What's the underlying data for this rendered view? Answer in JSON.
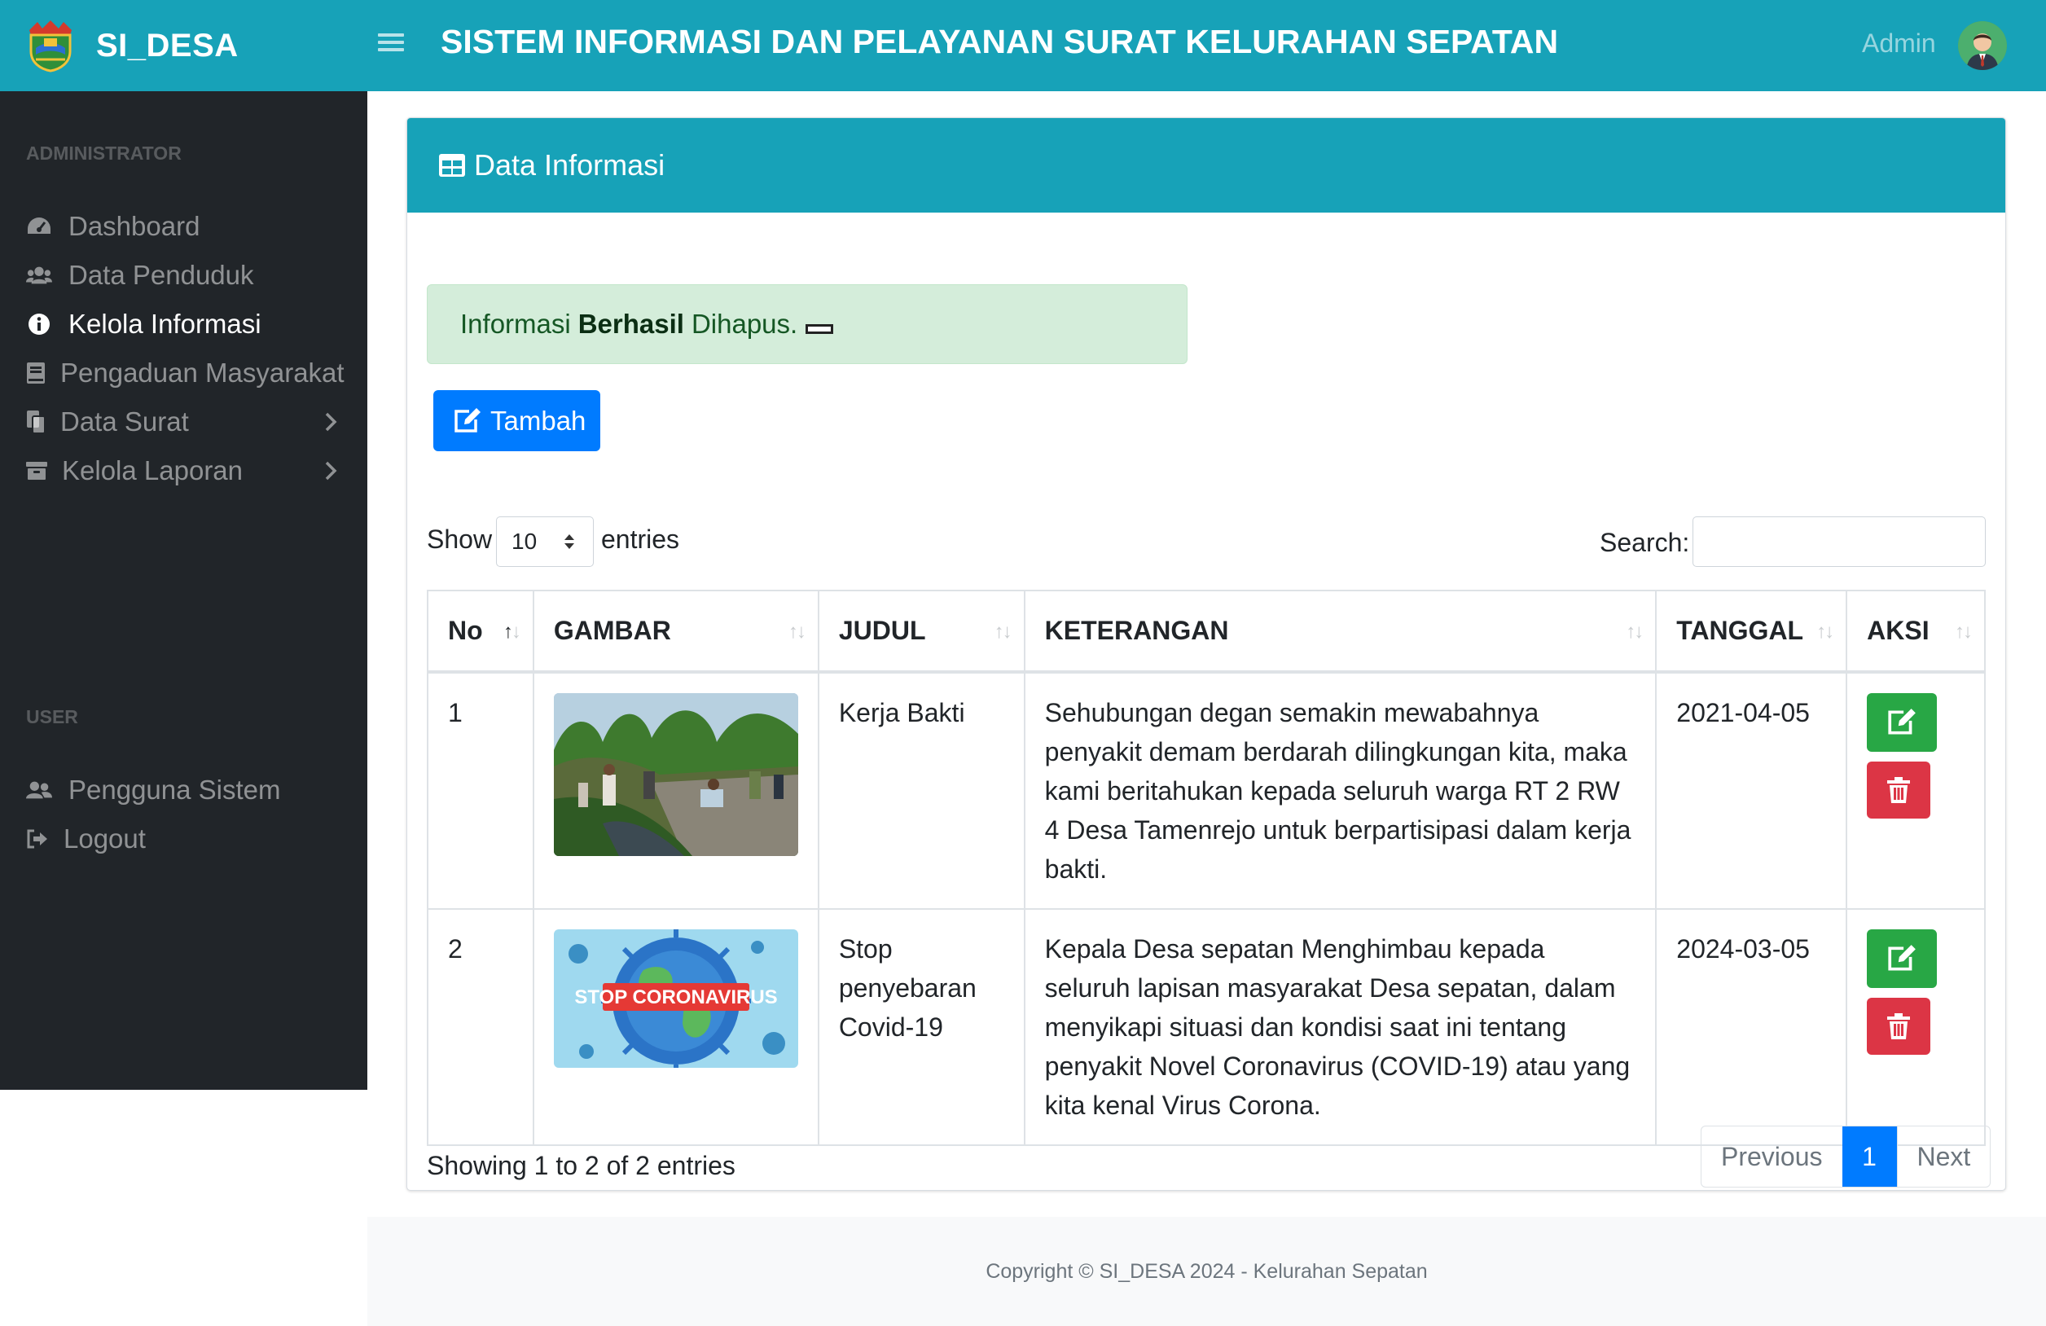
{
  "navbar": {
    "brand": "SI_DESA",
    "title": "SISTEM INFORMASI DAN PELAYANAN SURAT KELURAHAN SEPATAN",
    "user": "Admin"
  },
  "sidebar": {
    "heading_admin": "ADMINISTRATOR",
    "heading_user": "USER",
    "items": [
      {
        "label": "Dashboard",
        "icon": "tachometer-icon"
      },
      {
        "label": "Data Penduduk",
        "icon": "users-icon"
      },
      {
        "label": "Kelola Informasi",
        "icon": "info-circle-icon",
        "active": true
      },
      {
        "label": "Pengaduan Masyarakat",
        "icon": "book-icon"
      },
      {
        "label": "Data Surat",
        "icon": "copy-icon",
        "has_submenu": true
      },
      {
        "label": "Kelola Laporan",
        "icon": "archive-icon",
        "has_submenu": true
      }
    ],
    "user_items": [
      {
        "label": "Pengguna Sistem",
        "icon": "user-friends-icon"
      },
      {
        "label": "Logout",
        "icon": "sign-out-icon"
      }
    ]
  },
  "card": {
    "title": "Data Informasi",
    "header_color": "#17a2b8"
  },
  "alert": {
    "prefix": "Informasi",
    "bold": "Berhasil",
    "suffix": "Dihapus."
  },
  "add_button": "Tambah",
  "datatable": {
    "show_label": "Show",
    "entries_label": "entries",
    "page_size": "10",
    "search_label": "Search:",
    "search_value": "",
    "columns": [
      "No",
      "GAMBAR",
      "JUDUL",
      "KETERANGAN",
      "TANGGAL",
      "AKSI"
    ],
    "rows": [
      {
        "no": "1",
        "image": "kerja-bakti-photo",
        "judul": "Kerja Bakti",
        "keterangan": "Sehubungan degan semakin mewabahnya penyakit demam berdarah dilingkungan kita, maka kami beritahukan kepada seluruh warga RT 2 RW 4 Desa Tamenrejo untuk berpartisipasi dalam kerja bakti.",
        "tanggal": "2021-04-05"
      },
      {
        "no": "2",
        "image": "stop-coronavirus-illustration",
        "image_text": "STOP CORONAVIRUS",
        "judul": "Stop penyebaran Covid-19",
        "keterangan": "Kepala Desa sepatan Menghimbau kepada seluruh lapisan masyarakat Desa sepatan, dalam menyikapi situasi dan kondisi saat ini tentang penyakit Novel Coronavirus (COVID-19) atau yang kita kenal Virus Corona.",
        "tanggal": "2024-03-05"
      }
    ],
    "info": "Showing 1 to 2 of 2 entries",
    "pagination": {
      "previous": "Previous",
      "current": "1",
      "next": "Next"
    }
  },
  "footer": "Copyright © SI_DESA 2024 - Kelurahan Sepatan",
  "colors": {
    "primary": "#007bff",
    "success": "#28a745",
    "danger": "#dc3545",
    "sidebar_bg": "#212529",
    "alert_bg": "#d4edda"
  }
}
